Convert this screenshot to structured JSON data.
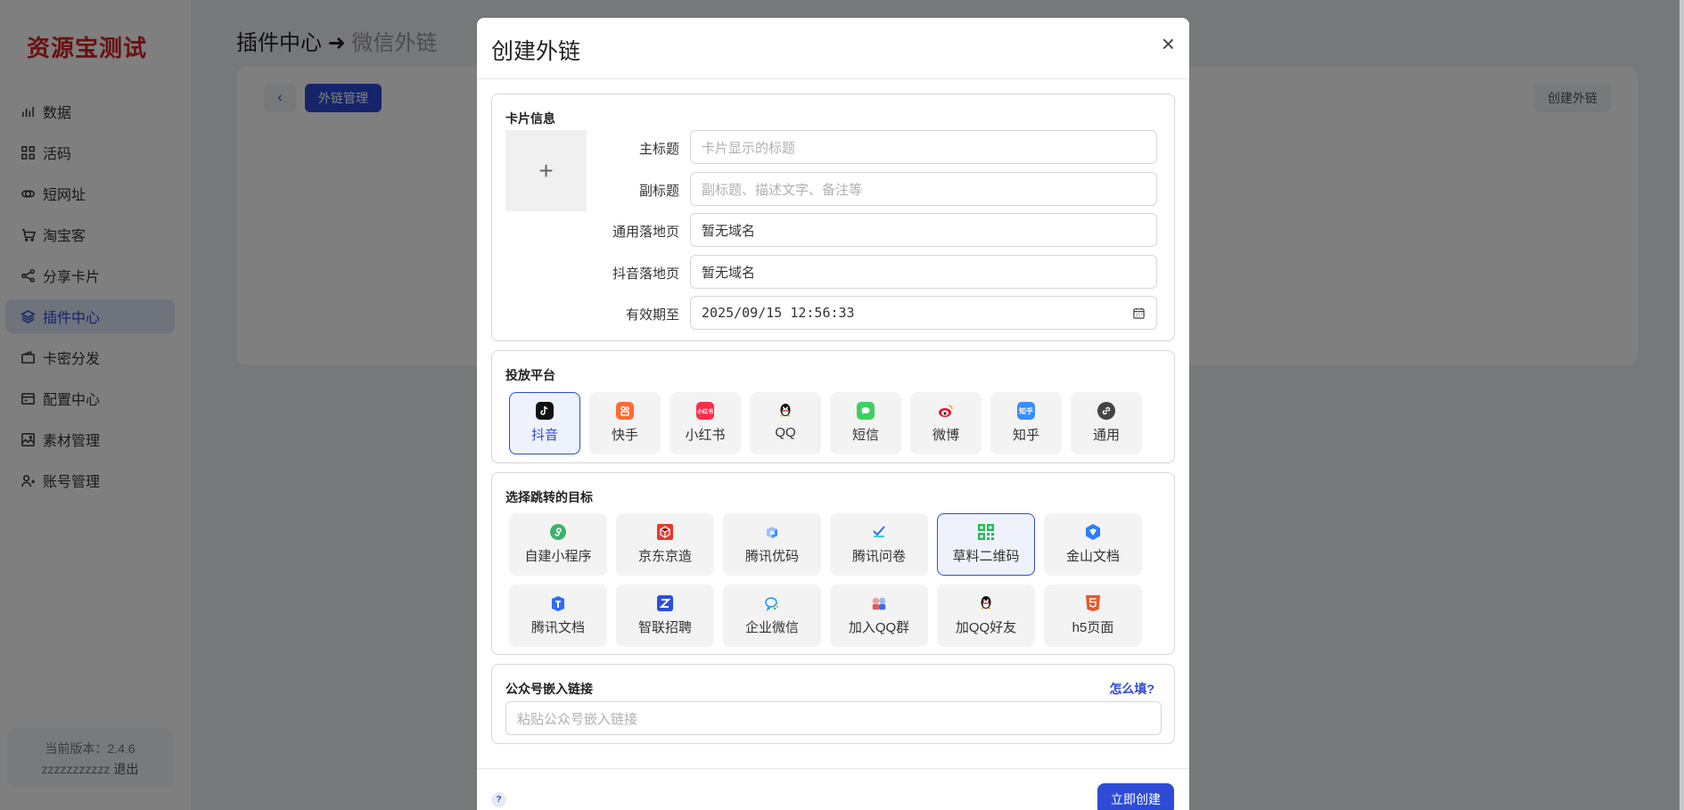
{
  "brand": "资源宝测试",
  "sidebar": {
    "items": [
      {
        "label": "数据",
        "icon": "bar-chart-icon"
      },
      {
        "label": "活码",
        "icon": "grid-icon"
      },
      {
        "label": "短网址",
        "icon": "link-icon"
      },
      {
        "label": "淘宝客",
        "icon": "cart-icon"
      },
      {
        "label": "分享卡片",
        "icon": "share-icon"
      },
      {
        "label": "插件中心",
        "icon": "layers-icon",
        "active": true
      },
      {
        "label": "卡密分发",
        "icon": "wallet-icon"
      },
      {
        "label": "配置中心",
        "icon": "card-icon"
      },
      {
        "label": "素材管理",
        "icon": "image-icon"
      },
      {
        "label": "账号管理",
        "icon": "user-add-icon"
      }
    ],
    "version_text": "当前版本：2.4.6",
    "username": "zzzzzzzzzzz",
    "logout_label": "退出"
  },
  "page": {
    "breadcrumb_main": "插件中心",
    "breadcrumb_arrow": "➜",
    "breadcrumb_sub": "微信外链",
    "back_label": "‹",
    "tab_label": "外链管理",
    "create_label": "创建外链"
  },
  "modal": {
    "title": "创建外链",
    "close": "×",
    "card_section": {
      "title": "卡片信息",
      "upload_symbol": "+",
      "fields": {
        "main_title": {
          "label": "主标题",
          "placeholder": "卡片显示的标题"
        },
        "subtitle": {
          "label": "副标题",
          "placeholder": "副标题、描述文字、备注等"
        },
        "common_landing": {
          "label": "通用落地页",
          "value": "暂无域名"
        },
        "douyin_landing": {
          "label": "抖音落地页",
          "value": "暂无域名"
        },
        "expiry": {
          "label": "有效期至",
          "value": "2025/09/15 12:56:33"
        }
      }
    },
    "platform_section": {
      "title": "投放平台",
      "items": [
        {
          "label": "抖音",
          "icon": "douyin-icon",
          "color": "#111111",
          "active": true
        },
        {
          "label": "快手",
          "icon": "kuaishou-icon",
          "color": "#ff6a33"
        },
        {
          "label": "小红书",
          "icon": "xiaohongshu-icon",
          "color": "#ff2d4a",
          "text": "小红书"
        },
        {
          "label": "QQ",
          "icon": "qq-icon",
          "color": "#111111"
        },
        {
          "label": "短信",
          "icon": "sms-icon",
          "color": "#3dd15f"
        },
        {
          "label": "微博",
          "icon": "weibo-icon",
          "color": "#f5a623"
        },
        {
          "label": "知乎",
          "icon": "zhihu-icon",
          "color": "#3a8cff",
          "text": "知乎"
        },
        {
          "label": "通用",
          "icon": "link-icon",
          "color": "#444444"
        }
      ]
    },
    "target_section": {
      "title": "选择跳转的目标",
      "rows": [
        [
          {
            "label": "自建小程序",
            "icon": "miniprogram-icon",
            "color": "#3bb36a"
          },
          {
            "label": "京东京造",
            "icon": "jd-icon",
            "color": "#e33b2e"
          },
          {
            "label": "腾讯优码",
            "icon": "tencent-youma-icon",
            "color": "#3a8cff"
          },
          {
            "label": "腾讯问卷",
            "icon": "tencent-survey-icon",
            "color": "#2f6cff"
          },
          {
            "label": "草料二维码",
            "icon": "qrcode-icon",
            "color": "#2eb85c",
            "active": true
          },
          {
            "label": "金山文档",
            "icon": "kdocs-icon",
            "color": "#2b7cff"
          }
        ],
        [
          {
            "label": "腾讯文档",
            "icon": "tencent-docs-icon",
            "color": "#2f6cff"
          },
          {
            "label": "智联招聘",
            "icon": "zhaopin-icon",
            "color": "#2b4fe0"
          },
          {
            "label": "企业微信",
            "icon": "wecom-icon",
            "color": "#2a9cf0"
          },
          {
            "label": "加入QQ群",
            "icon": "qq-group-icon",
            "color": "#e05a5a"
          },
          {
            "label": "加QQ好友",
            "icon": "qq-friend-icon",
            "color": "#111111"
          },
          {
            "label": "h5页面",
            "icon": "html5-icon",
            "color": "#e8572a"
          }
        ]
      ]
    },
    "embed_section": {
      "title": "公众号嵌入链接",
      "help_label": "怎么填?",
      "placeholder": "粘贴公众号嵌入链接"
    },
    "help_icon": "?",
    "submit_label": "立即创建"
  },
  "colors": {
    "brand": "#d32020",
    "accent": "#2d4bd6"
  }
}
